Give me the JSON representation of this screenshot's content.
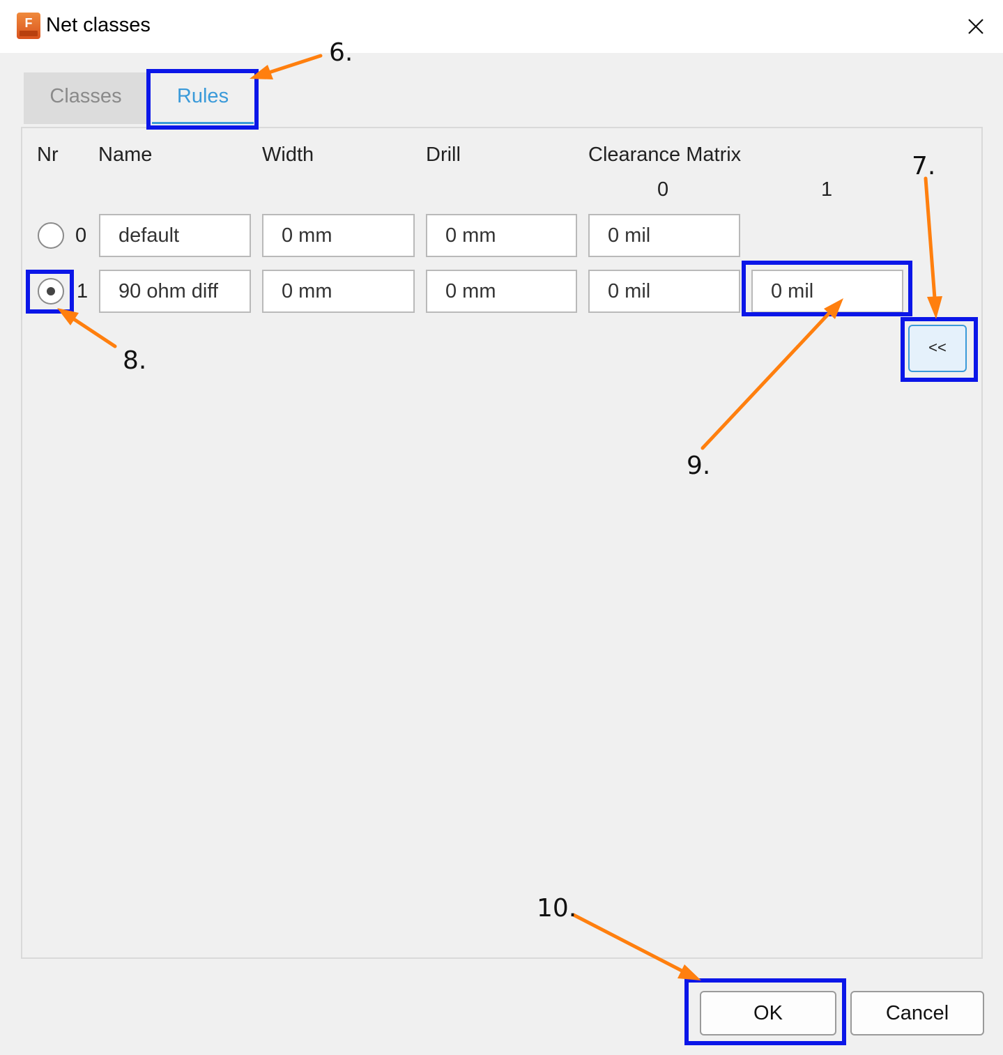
{
  "window": {
    "title": "Net classes",
    "app_icon_letter": "F",
    "close_label": "close"
  },
  "tabs": [
    {
      "label": "Classes",
      "active": false
    },
    {
      "label": "Rules",
      "active": true
    }
  ],
  "headers": {
    "nr": "Nr",
    "name": "Name",
    "width": "Width",
    "drill": "Drill",
    "clearance_matrix": "Clearance Matrix",
    "matrix_cols": [
      "0",
      "1"
    ]
  },
  "rows": [
    {
      "nr": "0",
      "selected": false,
      "name": "default",
      "width": "0 mm",
      "drill": "0 mm",
      "clearance": [
        "0 mil"
      ]
    },
    {
      "nr": "1",
      "selected": true,
      "name": "90 ohm diff",
      "width": "0 mm",
      "drill": "0 mm",
      "clearance": [
        "0 mil",
        "0 mil"
      ]
    }
  ],
  "collapse_button": "<<",
  "buttons": {
    "ok": "OK",
    "cancel": "Cancel"
  },
  "callouts": {
    "c6": "6.",
    "c7": "7.",
    "c8": "8.",
    "c9": "9.",
    "c10": "10."
  },
  "colors": {
    "highlight": "#0b16e8",
    "arrow": "#ff7f0e",
    "active_tab": "#3a9ad9"
  }
}
